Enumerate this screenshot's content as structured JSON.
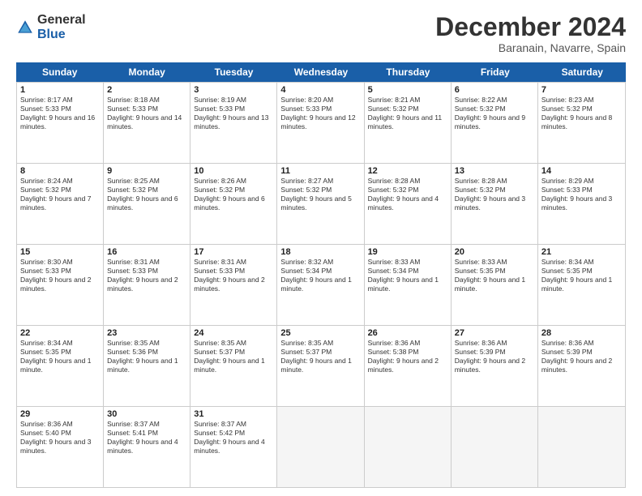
{
  "logo": {
    "general": "General",
    "blue": "Blue"
  },
  "title": "December 2024",
  "location": "Baranain, Navarre, Spain",
  "days": [
    "Sunday",
    "Monday",
    "Tuesday",
    "Wednesday",
    "Thursday",
    "Friday",
    "Saturday"
  ],
  "rows": [
    [
      {
        "day": "1",
        "sunrise": "8:17 AM",
        "sunset": "5:33 PM",
        "daylight": "9 hours and 16 minutes."
      },
      {
        "day": "2",
        "sunrise": "8:18 AM",
        "sunset": "5:33 PM",
        "daylight": "9 hours and 14 minutes."
      },
      {
        "day": "3",
        "sunrise": "8:19 AM",
        "sunset": "5:33 PM",
        "daylight": "9 hours and 13 minutes."
      },
      {
        "day": "4",
        "sunrise": "8:20 AM",
        "sunset": "5:33 PM",
        "daylight": "9 hours and 12 minutes."
      },
      {
        "day": "5",
        "sunrise": "8:21 AM",
        "sunset": "5:32 PM",
        "daylight": "9 hours and 11 minutes."
      },
      {
        "day": "6",
        "sunrise": "8:22 AM",
        "sunset": "5:32 PM",
        "daylight": "9 hours and 9 minutes."
      },
      {
        "day": "7",
        "sunrise": "8:23 AM",
        "sunset": "5:32 PM",
        "daylight": "9 hours and 8 minutes."
      }
    ],
    [
      {
        "day": "8",
        "sunrise": "8:24 AM",
        "sunset": "5:32 PM",
        "daylight": "9 hours and 7 minutes."
      },
      {
        "day": "9",
        "sunrise": "8:25 AM",
        "sunset": "5:32 PM",
        "daylight": "9 hours and 6 minutes."
      },
      {
        "day": "10",
        "sunrise": "8:26 AM",
        "sunset": "5:32 PM",
        "daylight": "9 hours and 6 minutes."
      },
      {
        "day": "11",
        "sunrise": "8:27 AM",
        "sunset": "5:32 PM",
        "daylight": "9 hours and 5 minutes."
      },
      {
        "day": "12",
        "sunrise": "8:28 AM",
        "sunset": "5:32 PM",
        "daylight": "9 hours and 4 minutes."
      },
      {
        "day": "13",
        "sunrise": "8:28 AM",
        "sunset": "5:32 PM",
        "daylight": "9 hours and 3 minutes."
      },
      {
        "day": "14",
        "sunrise": "8:29 AM",
        "sunset": "5:33 PM",
        "daylight": "9 hours and 3 minutes."
      }
    ],
    [
      {
        "day": "15",
        "sunrise": "8:30 AM",
        "sunset": "5:33 PM",
        "daylight": "9 hours and 2 minutes."
      },
      {
        "day": "16",
        "sunrise": "8:31 AM",
        "sunset": "5:33 PM",
        "daylight": "9 hours and 2 minutes."
      },
      {
        "day": "17",
        "sunrise": "8:31 AM",
        "sunset": "5:33 PM",
        "daylight": "9 hours and 2 minutes."
      },
      {
        "day": "18",
        "sunrise": "8:32 AM",
        "sunset": "5:34 PM",
        "daylight": "9 hours and 1 minute."
      },
      {
        "day": "19",
        "sunrise": "8:33 AM",
        "sunset": "5:34 PM",
        "daylight": "9 hours and 1 minute."
      },
      {
        "day": "20",
        "sunrise": "8:33 AM",
        "sunset": "5:35 PM",
        "daylight": "9 hours and 1 minute."
      },
      {
        "day": "21",
        "sunrise": "8:34 AM",
        "sunset": "5:35 PM",
        "daylight": "9 hours and 1 minute."
      }
    ],
    [
      {
        "day": "22",
        "sunrise": "8:34 AM",
        "sunset": "5:35 PM",
        "daylight": "9 hours and 1 minute."
      },
      {
        "day": "23",
        "sunrise": "8:35 AM",
        "sunset": "5:36 PM",
        "daylight": "9 hours and 1 minute."
      },
      {
        "day": "24",
        "sunrise": "8:35 AM",
        "sunset": "5:37 PM",
        "daylight": "9 hours and 1 minute."
      },
      {
        "day": "25",
        "sunrise": "8:35 AM",
        "sunset": "5:37 PM",
        "daylight": "9 hours and 1 minute."
      },
      {
        "day": "26",
        "sunrise": "8:36 AM",
        "sunset": "5:38 PM",
        "daylight": "9 hours and 2 minutes."
      },
      {
        "day": "27",
        "sunrise": "8:36 AM",
        "sunset": "5:39 PM",
        "daylight": "9 hours and 2 minutes."
      },
      {
        "day": "28",
        "sunrise": "8:36 AM",
        "sunset": "5:39 PM",
        "daylight": "9 hours and 2 minutes."
      }
    ],
    [
      {
        "day": "29",
        "sunrise": "8:36 AM",
        "sunset": "5:40 PM",
        "daylight": "9 hours and 3 minutes."
      },
      {
        "day": "30",
        "sunrise": "8:37 AM",
        "sunset": "5:41 PM",
        "daylight": "9 hours and 4 minutes."
      },
      {
        "day": "31",
        "sunrise": "8:37 AM",
        "sunset": "5:42 PM",
        "daylight": "9 hours and 4 minutes."
      },
      null,
      null,
      null,
      null
    ]
  ],
  "labels": {
    "sunrise": "Sunrise:",
    "sunset": "Sunset:",
    "daylight": "Daylight:"
  }
}
